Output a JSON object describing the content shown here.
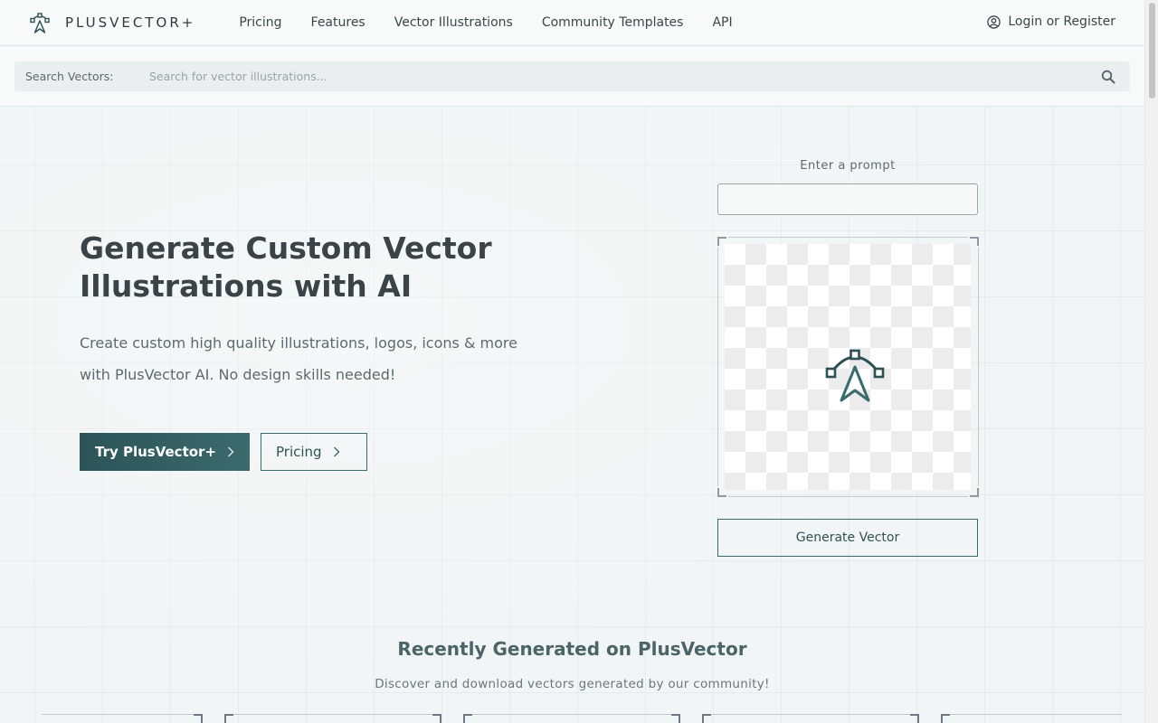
{
  "header": {
    "brand": "PLUSVECTOR+",
    "nav": [
      {
        "label": "Pricing"
      },
      {
        "label": "Features"
      },
      {
        "label": "Vector Illustrations"
      },
      {
        "label": "Community Templates"
      },
      {
        "label": "API"
      }
    ],
    "login_label": "Login or Register"
  },
  "search": {
    "label": "Search Vectors:",
    "placeholder": "Search for vector illustrations...",
    "value": ""
  },
  "hero": {
    "title": "Generate Custom Vector Illustrations with AI",
    "subtitle": "Create custom high quality illustrations, logos, icons & more with PlusVector AI. No design skills needed!",
    "primary_button": "Try PlusVector+",
    "secondary_button": "Pricing"
  },
  "generator": {
    "prompt_label": "Enter a prompt",
    "prompt_value": "",
    "generate_button": "Generate Vector"
  },
  "recent": {
    "title": "Recently Generated on PlusVector",
    "subtitle": "Discover and download vectors generated by our community!"
  },
  "icons": {
    "brand_logo": "pen-tool-icon",
    "login": "user-circle-icon",
    "search": "search-icon",
    "chevron": "chevron-right-icon",
    "canvas": "pen-tool-icon"
  },
  "colors": {
    "accent": "#2c5458",
    "accent_light": "#3b6a6d",
    "text": "#3a4448",
    "background": "#f2f5f5"
  }
}
